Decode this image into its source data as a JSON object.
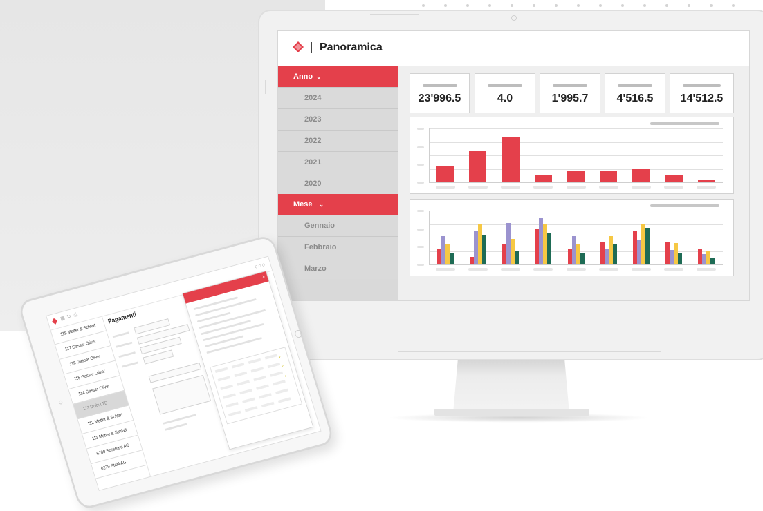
{
  "monitor": {
    "header": {
      "title": "Panoramica",
      "logo_icon": "diamond-logo-icon"
    },
    "sidebar": {
      "sections": [
        {
          "label": "Anno",
          "items": [
            "2024",
            "2023",
            "2022",
            "2021",
            "2020"
          ]
        },
        {
          "label": "Mese",
          "items": [
            "Gennaio",
            "Febbraio",
            "Marzo"
          ]
        }
      ]
    },
    "kpis": [
      "23'996.5",
      "4.0",
      "1'995.7",
      "4'516.5",
      "14'512.5"
    ],
    "colors": {
      "accent": "#e4404b",
      "purple": "#9b93cf",
      "yellow": "#f6c844",
      "green": "#1e6b55"
    }
  },
  "chart_data": [
    {
      "type": "bar",
      "series": [
        {
          "values": [
            24,
            46,
            67,
            11,
            17,
            17,
            20,
            10,
            4
          ]
        }
      ],
      "ylim": [
        0,
        80
      ]
    },
    {
      "type": "bar",
      "series": [
        {
          "values": [
            24,
            11,
            30,
            52,
            24,
            34,
            50,
            34,
            24
          ]
        },
        {
          "values": [
            42,
            50,
            62,
            70,
            42,
            24,
            37,
            22,
            15
          ]
        },
        {
          "values": [
            31,
            60,
            38,
            59,
            31,
            42,
            60,
            32,
            21
          ]
        },
        {
          "values": [
            17,
            44,
            21,
            46,
            17,
            30,
            54,
            17,
            10
          ]
        }
      ],
      "ylim": [
        0,
        80
      ]
    }
  ],
  "tablet": {
    "title": "Pagamenti",
    "icons": [
      "logo-icon",
      "grid-icon",
      "refresh-icon",
      "print-icon",
      "close-icon"
    ],
    "list": [
      "118 Matter & Schlatt",
      "117 Gasser Oliver",
      "116 Gasser Oliver",
      "115 Gasser Oliver",
      "114 Gasser Oliver",
      "113 Dolbi LTD",
      "112 Matter & Schlatt",
      "111 Matter & Schlatt",
      "6280 Bosshard AG",
      "6279 Stahl AG"
    ],
    "selected_index": 5
  }
}
